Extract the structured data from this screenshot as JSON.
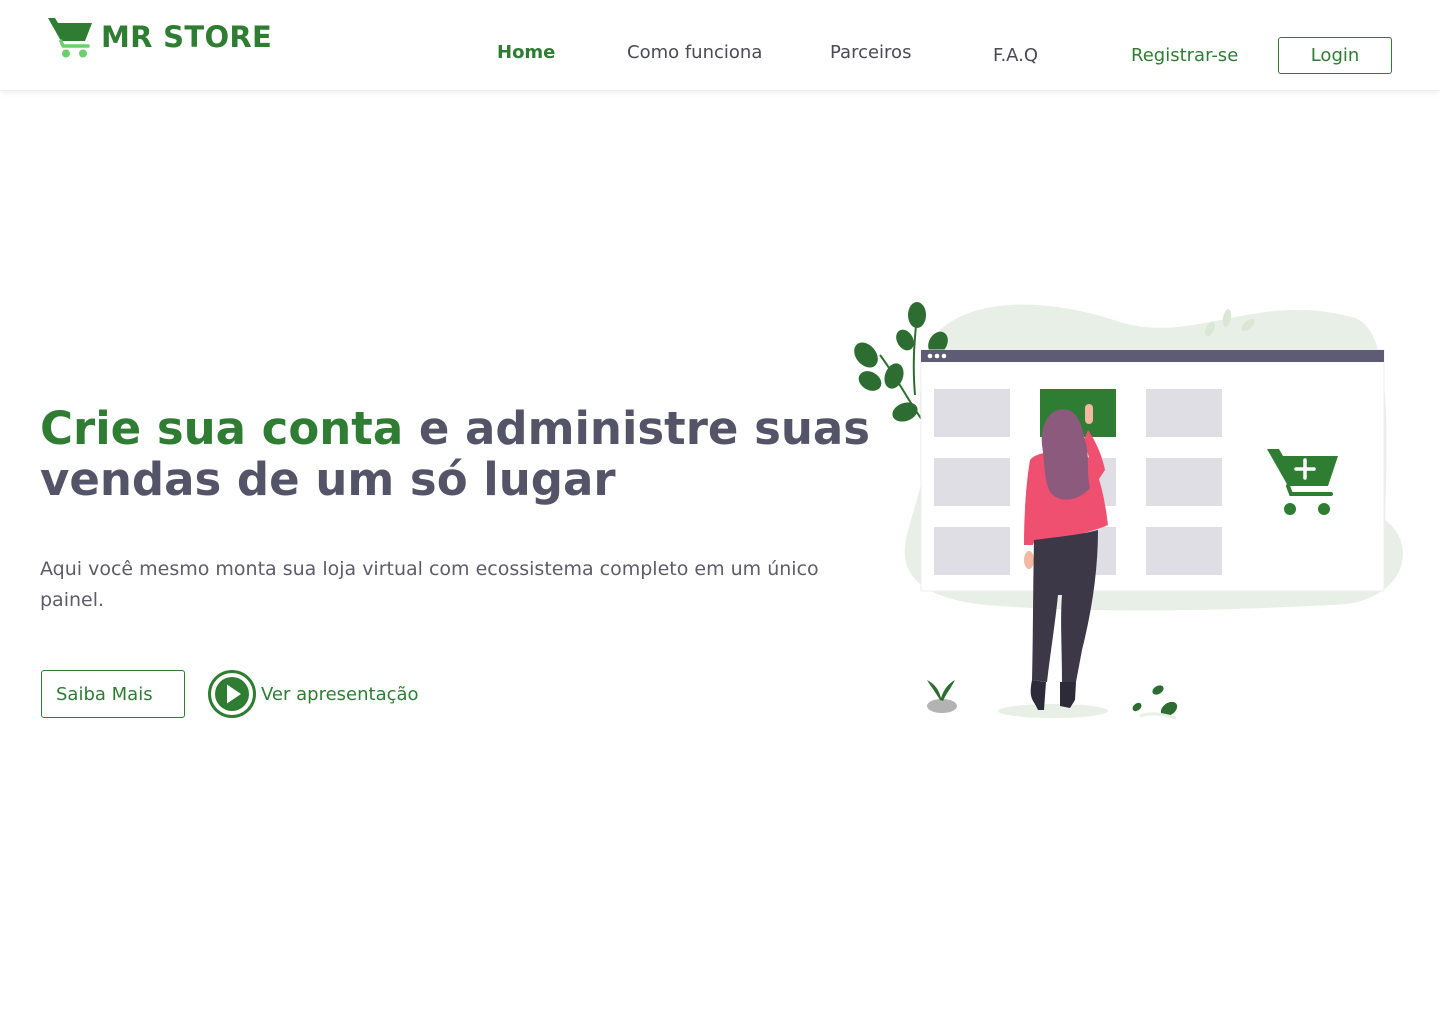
{
  "brand": {
    "name": "MR STORE",
    "icon": "shopping-cart-icon",
    "color_primary": "#2e7d32",
    "color_light": "#8bd67f"
  },
  "nav": {
    "items": [
      {
        "label": "Home",
        "active": true
      },
      {
        "label": "Como funciona",
        "active": false
      },
      {
        "label": "Parceiros",
        "active": false
      },
      {
        "label": "F.A.Q",
        "active": false
      }
    ],
    "register_label": "Registrar-se",
    "login_label": "Login"
  },
  "hero": {
    "title_highlight": "Crie sua conta",
    "title_rest": " e administre suas vendas de um só lugar",
    "subtitle": "Aqui você mesmo monta sua loja virtual com ecossistema completo em um único painel.",
    "primary_button": "Saiba Mais",
    "video_link": "Ver apresentação",
    "video_icon": "play-circle-icon"
  },
  "illustration": {
    "description_icon": "woman-choosing-product-illustration",
    "cart_icon": "cart-plus-icon",
    "colors": {
      "window_bar": "#5e5b75",
      "tile": "#dfdee4",
      "tile_selected": "#2e7d32",
      "blob": "#e8efe6",
      "shirt": "#f0506f",
      "pants": "#3c3848",
      "hair": "#8c5a7d"
    }
  }
}
